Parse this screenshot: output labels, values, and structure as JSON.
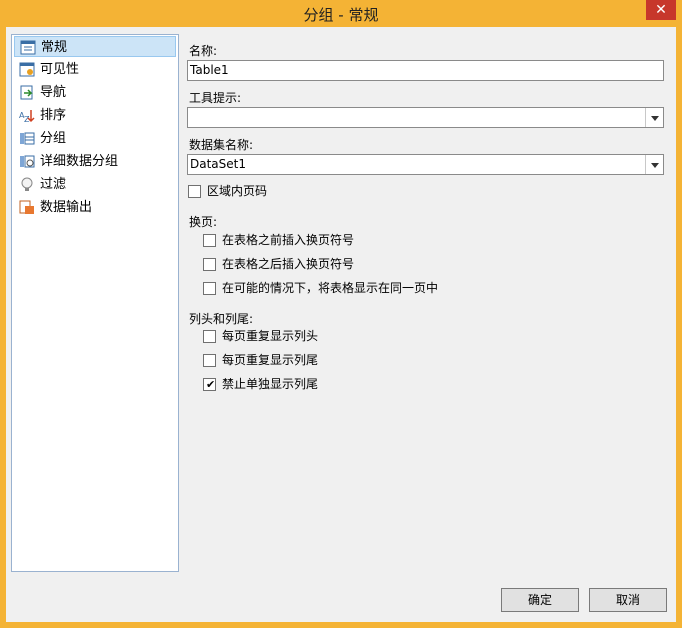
{
  "window": {
    "title": "分组 - 常规",
    "close": "✕"
  },
  "nav": {
    "items": [
      {
        "label": "常规",
        "icon": "general-icon"
      },
      {
        "label": "可见性",
        "icon": "visibility-icon"
      },
      {
        "label": "导航",
        "icon": "navigation-icon"
      },
      {
        "label": "排序",
        "icon": "sort-icon"
      },
      {
        "label": "分组",
        "icon": "group-icon"
      },
      {
        "label": "详细数据分组",
        "icon": "detail-group-icon"
      },
      {
        "label": "过滤",
        "icon": "filter-icon"
      },
      {
        "label": "数据输出",
        "icon": "data-output-icon"
      }
    ]
  },
  "form": {
    "name_label": "名称:",
    "name_value": "Table1",
    "tooltip_label": "工具提示:",
    "tooltip_value": "",
    "dataset_label": "数据集名称:",
    "dataset_value": "DataSet1",
    "page_number_label": "区域内页码",
    "page_break_label": "换页:",
    "break_before_label": "在表格之前插入换页符号",
    "break_after_label": "在表格之后插入换页符号",
    "keep_together_label": "在可能的情况下，将表格显示在同一页中",
    "header_footer_label": "列头和列尾:",
    "repeat_header_label": "每页重复显示列头",
    "repeat_footer_label": "每页重复显示列尾",
    "no_single_footer_label": "禁止单独显示列尾"
  },
  "checks": {
    "page_number": false,
    "break_before": false,
    "break_after": false,
    "keep_together": false,
    "repeat_header": false,
    "repeat_footer": false,
    "no_single_footer": true
  },
  "buttons": {
    "ok": "确定",
    "cancel": "取消"
  },
  "colors": {
    "titlebar": "#f4b335",
    "close": "#c7372b",
    "selection": "#cce4f7"
  }
}
